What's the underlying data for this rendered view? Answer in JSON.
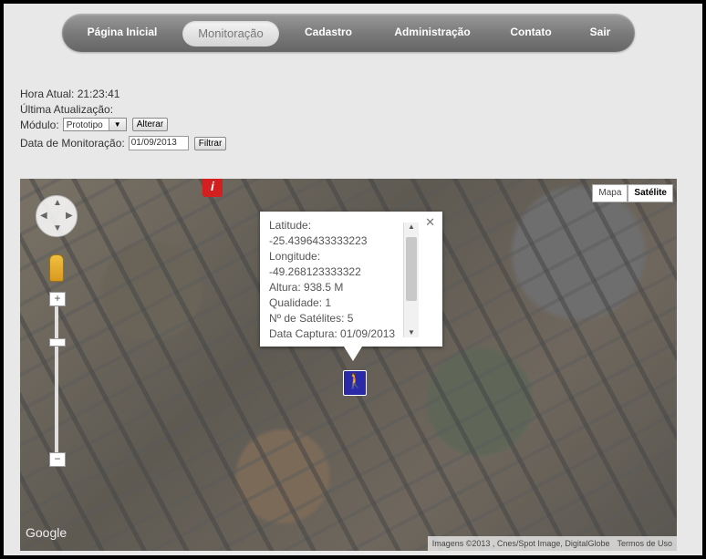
{
  "nav": {
    "items": [
      "Página Inicial",
      "Monitoração",
      "Cadastro",
      "Administração",
      "Contato",
      "Sair"
    ],
    "active": "Monitoração"
  },
  "info": {
    "hora_atual": "Hora Atual: 21:23:41",
    "ultima_atualizacao": "Última Atualização:",
    "modulo_label": "Módulo:",
    "modulo_value": "Prototipo",
    "alterar_button": "Alterar",
    "data_label": "Data de Monitoração:",
    "data_value": "01/09/2013",
    "filtrar_button": "Filtrar"
  },
  "map": {
    "type_buttons": [
      "Mapa",
      "Satélite"
    ],
    "selected_type": "Satélite",
    "info_window": {
      "lines": [
        "Latitude:",
        "-25.4396433333223",
        "Longitude:",
        "-49.268123333322",
        "Altura: 938.5 M",
        "Qualidade: 1",
        "Nº de Satélites: 5",
        "Data Captura: 01/09/2013"
      ]
    },
    "logo": "Google",
    "attribution": "Imagens ©2013 , Cnes/Spot Image, DigitalGlobe",
    "terms": "Termos de Uso"
  }
}
